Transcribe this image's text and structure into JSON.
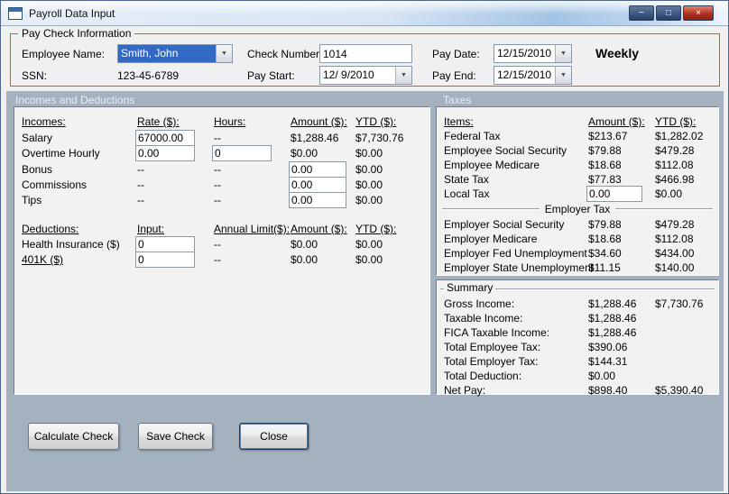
{
  "window": {
    "title": "Payroll Data Input",
    "controls": {
      "minimize": "−",
      "maximize": "□",
      "close": "×"
    }
  },
  "icons": {
    "dropdown_arrow": "▼"
  },
  "paycheck": {
    "group_label": "Pay Check Information",
    "employee_name": {
      "label": "Employee Name:",
      "value": "Smith, John"
    },
    "ssn": {
      "label": "SSN:",
      "value": "123-45-6789"
    },
    "check_number": {
      "label": "Check Number:",
      "value": "1014"
    },
    "pay_start": {
      "label": "Pay Start:",
      "value": "12/ 9/2010"
    },
    "pay_date": {
      "label": "Pay Date:",
      "value": "12/15/2010"
    },
    "pay_end": {
      "label": "Pay End:",
      "value": "12/15/2010"
    },
    "frequency": "Weekly"
  },
  "sections": {
    "incomes_deductions": "Incomes and Deductions",
    "taxes": "Taxes"
  },
  "incomes": {
    "headers": {
      "name": "Incomes:",
      "rate": "Rate ($):",
      "hours": "Hours:",
      "amount": "Amount ($):",
      "ytd": "YTD ($):"
    },
    "rows": [
      {
        "label": "Salary",
        "rate": "67000.00",
        "hours": "--",
        "amount": "$1,288.46",
        "ytd": "$7,730.76"
      },
      {
        "label": "Overtime Hourly",
        "rate": "0.00",
        "hours": "0",
        "amount": "$0.00",
        "ytd": "$0.00"
      },
      {
        "label": "Bonus",
        "rate": "--",
        "hours": "--",
        "amount": "0.00",
        "ytd": "$0.00"
      },
      {
        "label": "Commissions",
        "rate": "--",
        "hours": "--",
        "amount": "0.00",
        "ytd": "$0.00"
      },
      {
        "label": "Tips",
        "rate": "--",
        "hours": "--",
        "amount": "0.00",
        "ytd": "$0.00"
      }
    ]
  },
  "deductions": {
    "headers": {
      "name": "Deductions:",
      "input": "Input:",
      "limit": "Annual Limit($):",
      "amount": "Amount ($):",
      "ytd": "YTD ($):"
    },
    "rows": [
      {
        "label": "Health Insurance ($)",
        "input": "0",
        "limit": "--",
        "amount": "$0.00",
        "ytd": "$0.00"
      },
      {
        "label": "401K ($)",
        "input": "0",
        "limit": "--",
        "amount": "$0.00",
        "ytd": "$0.00"
      }
    ]
  },
  "taxes": {
    "headers": {
      "items": "Items:",
      "amount": "Amount ($):",
      "ytd": "YTD ($):"
    },
    "employee_rows": [
      {
        "label": "Federal Tax",
        "amount": "$213.67",
        "ytd": "$1,282.02"
      },
      {
        "label": "Employee Social Security",
        "amount": "$79.88",
        "ytd": "$479.28"
      },
      {
        "label": "Employee Medicare",
        "amount": "$18.68",
        "ytd": "$112.08"
      },
      {
        "label": "State Tax",
        "amount": "$77.83",
        "ytd": "$466.98"
      },
      {
        "label": "Local Tax",
        "amount": "0.00",
        "ytd": "$0.00"
      }
    ],
    "employer_separator": "Employer Tax",
    "employer_rows": [
      {
        "label": "Employer Social Security",
        "amount": "$79.88",
        "ytd": "$479.28"
      },
      {
        "label": "Employer Medicare",
        "amount": "$18.68",
        "ytd": "$112.08"
      },
      {
        "label": "Employer Fed Unemployment",
        "amount": "$34.60",
        "ytd": "$434.00"
      },
      {
        "label": "Employer State Unemployment",
        "amount": "$11.15",
        "ytd": "$140.00"
      }
    ]
  },
  "summary": {
    "group_label": "Summary",
    "rows": [
      {
        "label": "Gross Income:",
        "amount": "$1,288.46",
        "ytd": "$7,730.76"
      },
      {
        "label": "Taxable Income:",
        "amount": "$1,288.46",
        "ytd": ""
      },
      {
        "label": "FICA Taxable Income:",
        "amount": "$1,288.46",
        "ytd": ""
      },
      {
        "label": "Total Employee Tax:",
        "amount": "$390.06",
        "ytd": ""
      },
      {
        "label": "Total Employer Tax:",
        "amount": "$144.31",
        "ytd": ""
      },
      {
        "label": "Total Deduction:",
        "amount": "$0.00",
        "ytd": ""
      },
      {
        "label": "Net Pay:",
        "amount": "$898.40",
        "ytd": "$5,390.40"
      }
    ]
  },
  "buttons": {
    "calculate": "Calculate Check",
    "save": "Save Check",
    "close": "Close"
  },
  "colors": {
    "selection_blue": "#316ac5",
    "paycheck_border_red": "#b65c58",
    "section_background": "#a4b2c0",
    "close_button_red": "#b1301e"
  }
}
